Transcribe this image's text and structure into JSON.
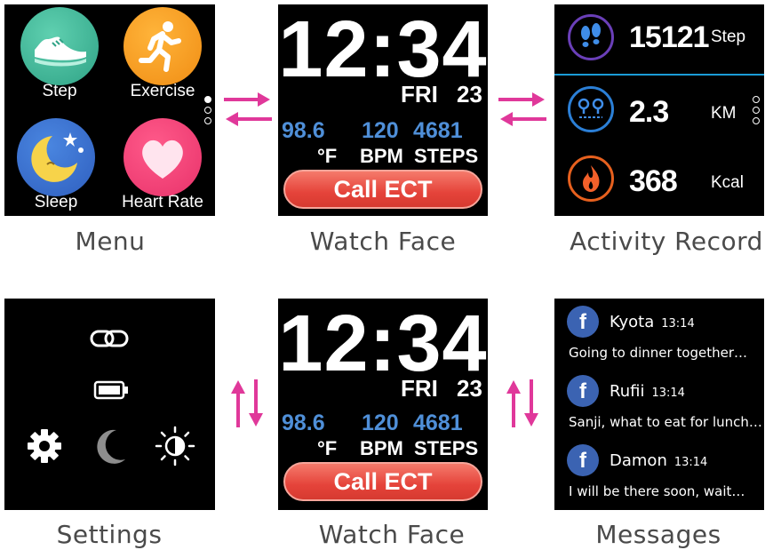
{
  "menu": {
    "apps": [
      {
        "label": "Step",
        "icon": "shoe-icon"
      },
      {
        "label": "Exercise",
        "icon": "running-person-icon"
      },
      {
        "label": "Sleep",
        "icon": "moon-stars-icon"
      },
      {
        "label": "Heart Rate",
        "icon": "heart-icon"
      }
    ],
    "caption": "Menu"
  },
  "watchface": {
    "time": "12:34",
    "day": "FRI",
    "date": "23",
    "temp_value": "98.6",
    "temp_unit": "°F",
    "bpm_value": "120",
    "bpm_unit": "BPM",
    "steps_value": "4681",
    "steps_unit": "STEPS",
    "call_button": "Call ECT",
    "caption": "Watch Face"
  },
  "activity": {
    "rows": [
      {
        "value": "15121",
        "unit": "Step",
        "icon": "footprints-icon"
      },
      {
        "value": "2.3",
        "unit": "KM",
        "icon": "route-icon"
      },
      {
        "value": "368",
        "unit": "Kcal",
        "icon": "flame-icon"
      }
    ],
    "caption": "Activity Record"
  },
  "settings": {
    "icons": [
      "link-icon",
      "battery-icon",
      "gear-icon",
      "moon-icon",
      "brightness-icon"
    ],
    "caption": "Settings"
  },
  "watchface2": {
    "caption": "Watch Face"
  },
  "messages": {
    "items": [
      {
        "name": "Kyota",
        "time": "13:14",
        "text": "Going to dinner together…"
      },
      {
        "name": "Rufii",
        "time": "13:14",
        "text": "Sanji, what to eat for lunch…"
      },
      {
        "name": "Damon",
        "time": "13:14",
        "text": "I will be there soon, wait…"
      }
    ],
    "caption": "Messages"
  },
  "colors": {
    "arrow": "#e0389a",
    "accent_blue": "#4f8fd8",
    "call_button": "#e5433a"
  }
}
